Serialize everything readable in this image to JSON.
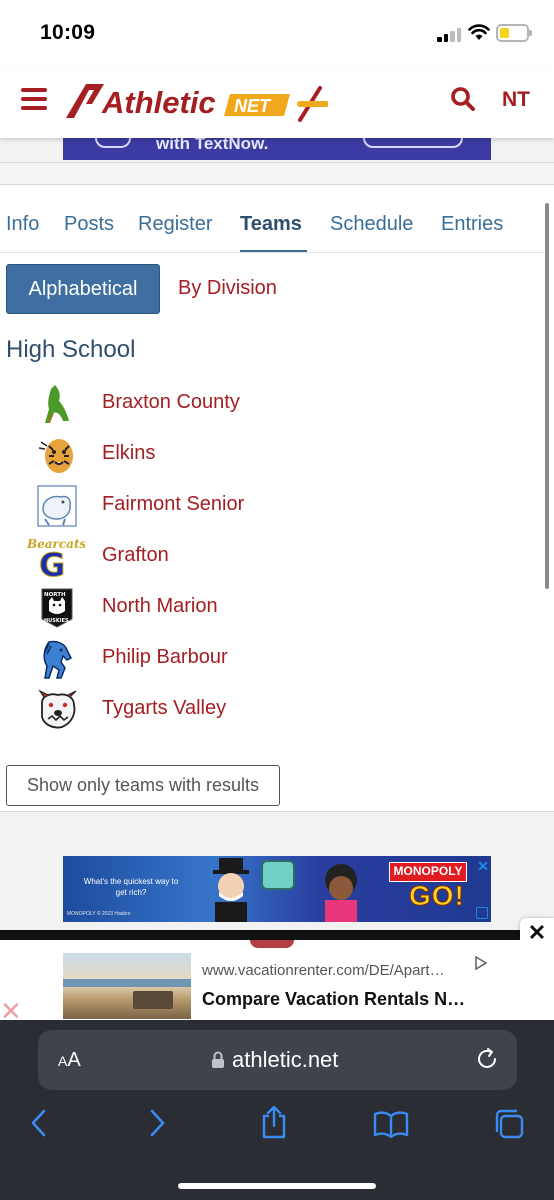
{
  "status_bar": {
    "time": "10:09"
  },
  "header": {
    "logo_text": "Athletic",
    "logo_net": "NET",
    "user_initials": "NT",
    "accent_color": "#a41e22",
    "logo_yellow": "#f2a81d"
  },
  "top_ad": {
    "text": "with TextNow."
  },
  "tabs": [
    {
      "label": "Info"
    },
    {
      "label": "Posts"
    },
    {
      "label": "Register"
    },
    {
      "label": "Teams",
      "active": true
    },
    {
      "label": "Schedule"
    },
    {
      "label": "Entries"
    }
  ],
  "sort": {
    "alphabetical_label": "Alphabetical",
    "by_division_label": "By Division"
  },
  "section_title": "High School",
  "teams": [
    {
      "name": "Braxton County",
      "icon": "braxton-logo-icon"
    },
    {
      "name": "Elkins",
      "icon": "tiger-logo-icon"
    },
    {
      "name": "Fairmont Senior",
      "icon": "polar-bear-logo-icon"
    },
    {
      "name": "Grafton",
      "icon": "bearcats-g-logo-icon"
    },
    {
      "name": "North Marion",
      "icon": "huskies-logo-icon"
    },
    {
      "name": "Philip Barbour",
      "icon": "colt-logo-icon"
    },
    {
      "name": "Tygarts Valley",
      "icon": "bulldog-logo-icon"
    }
  ],
  "results_button_label": "Show only teams with results",
  "monopoly_ad": {
    "tagline": "What's the quickest way to get rich?",
    "brand": "MONOPOLY",
    "go": "GO!",
    "legal": "MONOPOLY © 2023 Hasbro"
  },
  "sticky_ad": {
    "url": "www.vacationrenter.com/DE/Apart…",
    "headline": "Compare Vacation Rentals N…",
    "close_label": "✕"
  },
  "browser": {
    "text_size_label_small": "A",
    "text_size_label_large": "A",
    "domain": "athletic.net"
  }
}
